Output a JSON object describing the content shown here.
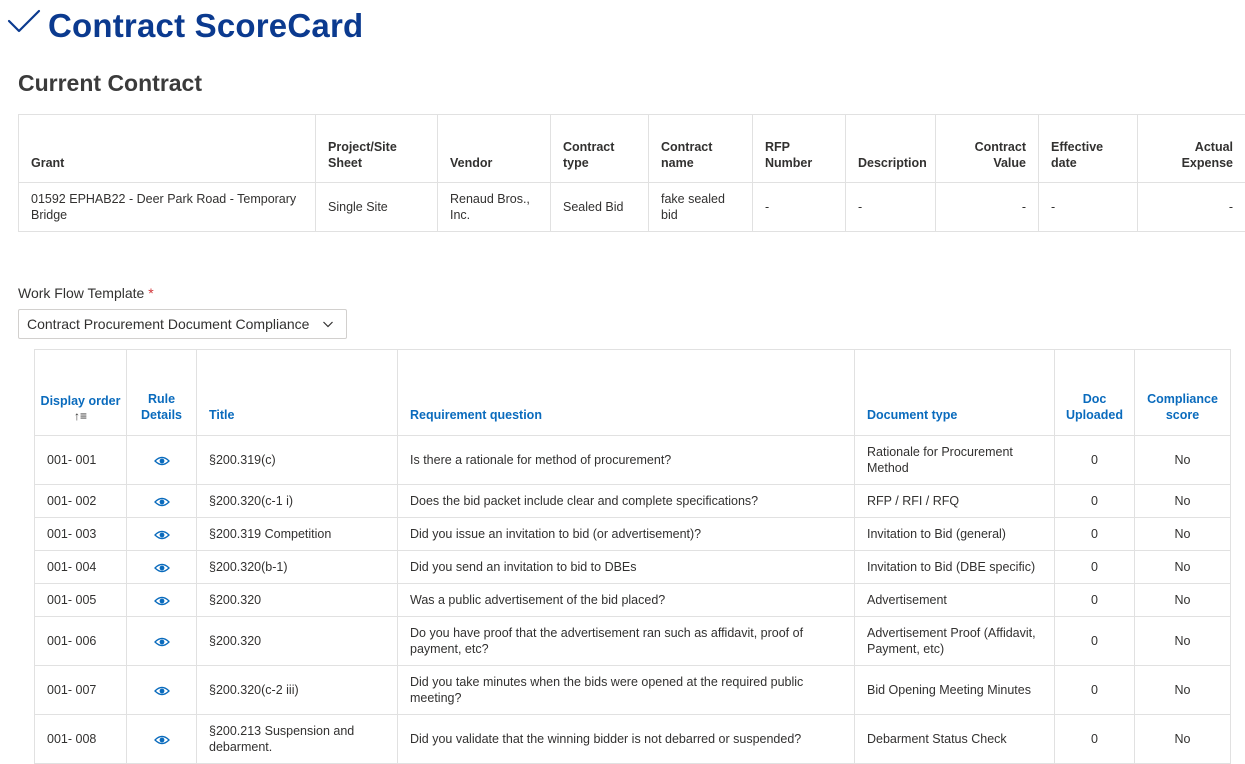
{
  "header": {
    "title": "Contract ScoreCard"
  },
  "current_contract": {
    "section_title": "Current Contract",
    "columns": [
      "Grant",
      "Project/Site Sheet",
      "Vendor",
      "Contract type",
      "Contract name",
      "RFP Number",
      "Description",
      "Contract Value",
      "Effective date",
      "Actual Expense"
    ],
    "row": {
      "grant": "01592 EPHAB22 - Deer Park Road - Temporary Bridge",
      "project": "Single Site",
      "vendor": "Renaud Bros., Inc.",
      "contract_type": "Sealed Bid",
      "contract_name": "fake sealed bid",
      "rfp_number": "-",
      "description": "-",
      "contract_value": "-",
      "effective_date": "-",
      "actual_expense": "-"
    }
  },
  "workflow": {
    "label": "Work Flow Template",
    "required_mark": "*",
    "selected": "Contract Procurement Document Compliance"
  },
  "requirements": {
    "columns": {
      "display_order": "Display order",
      "rule_details": "Rule Details",
      "title": "Title",
      "question": "Requirement question",
      "doc_type": "Document type",
      "doc_uploaded": "Doc Uploaded",
      "compliance": "Compliance score"
    },
    "sort_icon": "↑≡",
    "rows": [
      {
        "order": "001- 001",
        "title": "§200.319(c)",
        "question": "Is there a rationale for method of procurement?",
        "doc_type": "Rationale for Procurement Method",
        "uploaded": "0",
        "score": "No"
      },
      {
        "order": "001- 002",
        "title": "§200.320(c-1 i)",
        "question": "Does the bid packet include clear and complete specifications?",
        "doc_type": "RFP / RFI / RFQ",
        "uploaded": "0",
        "score": "No"
      },
      {
        "order": "001- 003",
        "title": "§200.319 Competition",
        "question": "Did you issue an invitation to bid (or advertisement)?",
        "doc_type": "Invitation to Bid (general)",
        "uploaded": "0",
        "score": "No"
      },
      {
        "order": "001- 004",
        "title": "§200.320(b-1)",
        "question": "Did you send an invitation to bid to DBEs",
        "doc_type": "Invitation to Bid (DBE specific)",
        "uploaded": "0",
        "score": "No"
      },
      {
        "order": "001- 005",
        "title": "§200.320",
        "question": "Was a public advertisement of the bid placed?",
        "doc_type": "Advertisement",
        "uploaded": "0",
        "score": "No"
      },
      {
        "order": "001- 006",
        "title": "§200.320",
        "question": "Do you have proof that the advertisement ran such as affidavit, proof of payment, etc?",
        "doc_type": "Advertisement Proof (Affidavit, Payment, etc)",
        "uploaded": "0",
        "score": "No"
      },
      {
        "order": "001- 007",
        "title": "§200.320(c-2 iii)",
        "question": "Did you take minutes when the bids were opened at the required public meeting?",
        "doc_type": "Bid Opening Meeting Minutes",
        "uploaded": "0",
        "score": "No"
      },
      {
        "order": "001- 008",
        "title": "§200.213 Suspension and debarment.",
        "question": "Did you validate that the winning bidder is not debarred or suspended?",
        "doc_type": "Debarment Status Check",
        "uploaded": "0",
        "score": "No"
      }
    ]
  }
}
